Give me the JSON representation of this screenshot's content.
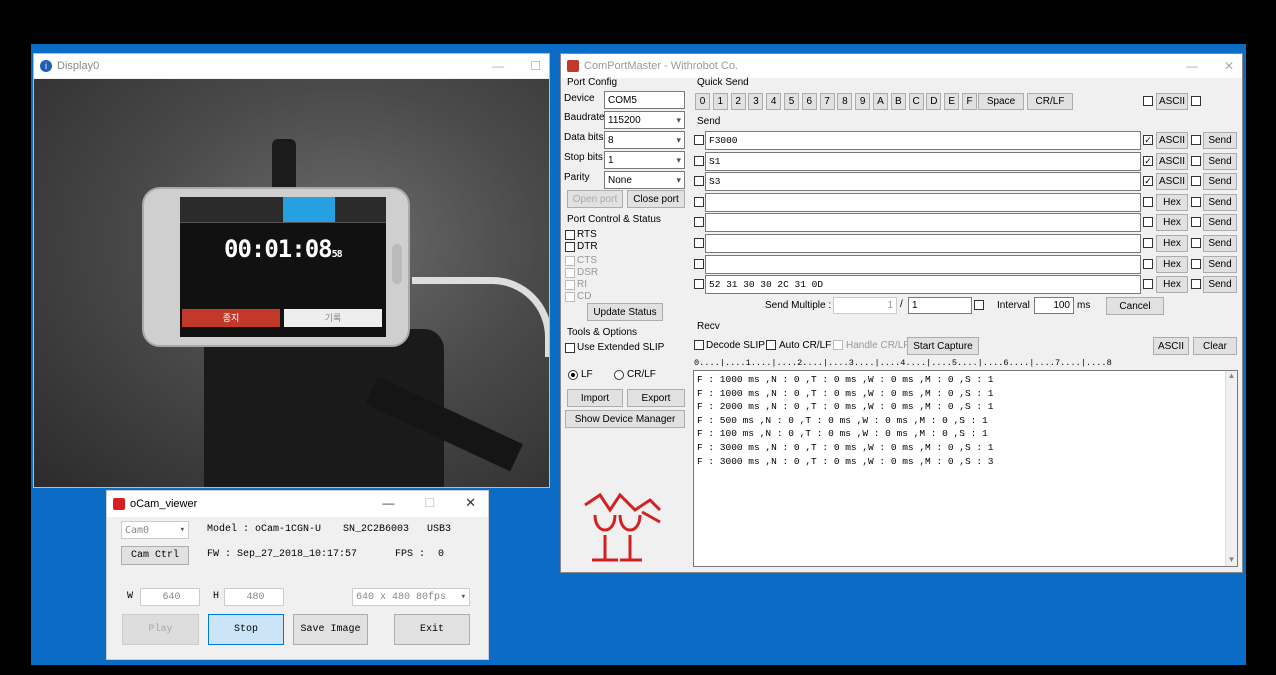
{
  "display_window": {
    "title": "Display0"
  },
  "phone_screen": {
    "time": "00:01:08",
    "time_small": "58",
    "stop_button": "종지",
    "lap_button": "기록"
  },
  "comport": {
    "title": "ComPortMaster - Withrobot Co.",
    "port_config_label": "Port Config",
    "device_label": "Device",
    "device_value": "COM5",
    "baud_label": "Baudrate",
    "baud_value": "115200",
    "databits_label": "Data bits",
    "databits_value": "8",
    "stopbits_label": "Stop bits",
    "stopbits_value": "1",
    "parity_label": "Parity",
    "parity_value": "None",
    "open_port": "Open port",
    "close_port": "Close port",
    "port_control_label": "Port Control & Status",
    "rts": "RTS",
    "dtr": "DTR",
    "cts": "CTS",
    "dsr": "DSR",
    "ri": "RI",
    "cd": "CD",
    "update_status": "Update Status",
    "tools_label": "Tools & Options",
    "use_ext_slip": "Use Extended SLIP",
    "lf": "LF",
    "crlf": "CR/LF",
    "import": "Import",
    "export": "Export",
    "show_device_manager": "Show Device Manager",
    "quick_send_label": "Quick Send",
    "quick_keys": [
      "0",
      "1",
      "2",
      "3",
      "4",
      "5",
      "6",
      "7",
      "8",
      "9",
      "A",
      "B",
      "C",
      "D",
      "E",
      "F"
    ],
    "space": "Space",
    "crlf_btn": "CR/LF",
    "ascii": "ASCII",
    "send_label": "Send",
    "send_rows": [
      {
        "text": "F3000",
        "mode": "ASCII",
        "checked": true
      },
      {
        "text": "S1",
        "mode": "ASCII",
        "checked": true
      },
      {
        "text": "S3",
        "mode": "ASCII",
        "checked": true
      },
      {
        "text": "",
        "mode": "Hex",
        "checked": false
      },
      {
        "text": "",
        "mode": "Hex",
        "checked": false
      },
      {
        "text": "",
        "mode": "Hex",
        "checked": false
      },
      {
        "text": "",
        "mode": "Hex",
        "checked": false
      },
      {
        "text": "52 31 30 30 2C 31 0D",
        "mode": "Hex",
        "checked": false
      }
    ],
    "send_btn": "Send",
    "send_multiple": "Send Multiple :",
    "send_multiple_a": "1",
    "send_multiple_sep": "/",
    "send_multiple_b": "1",
    "interval_label": "Interval",
    "interval_value": "100",
    "interval_unit": "ms",
    "cancel": "Cancel",
    "recv_label": "Recv",
    "decode_slip": "Decode SLIP",
    "auto_crlf": "Auto CR/LF",
    "handle_crlf": "Handle CR/LF",
    "start_capture": "Start Capture",
    "recv_ascii": "ASCII",
    "clear": "Clear",
    "ruler": "0....|....1....|....2....|....3....|....4....|....5....|....6....|....7....|....8",
    "recv_lines": [
      "F : 1000 ms ,N : 0 ,T : 0 ms ,W : 0 ms ,M : 0 ,S : 1",
      "F : 1000 ms ,N : 0 ,T : 0 ms ,W : 0 ms ,M : 0 ,S : 1",
      "F : 2000 ms ,N : 0 ,T : 0 ms ,W : 0 ms ,M : 0 ,S : 1",
      "F : 500 ms ,N : 0 ,T : 0 ms ,W : 0 ms ,M : 0 ,S : 1",
      "F : 100 ms ,N : 0 ,T : 0 ms ,W : 0 ms ,M : 0 ,S : 1",
      "F : 3000 ms ,N : 0 ,T : 0 ms ,W : 0 ms ,M : 0 ,S : 1",
      "F : 3000 ms ,N : 0 ,T : 0 ms ,W : 0 ms ,M : 0 ,S : 3"
    ]
  },
  "ocam": {
    "title": "oCam_viewer",
    "cam_select": "Cam0",
    "model": "Model : oCam-1CGN-U",
    "serial": "SN_2C2B6003",
    "usb": "USB3",
    "cam_ctrl": "Cam Ctrl",
    "fw": "FW : Sep_27_2018_10:17:57",
    "fps_label": "FPS :",
    "fps_value": "0",
    "w_label": "W",
    "w_value": "640",
    "h_label": "H",
    "h_value": "480",
    "res_select": "640 x 480  80fps",
    "play": "Play",
    "stop": "Stop",
    "save_image": "Save Image",
    "exit": "Exit"
  }
}
